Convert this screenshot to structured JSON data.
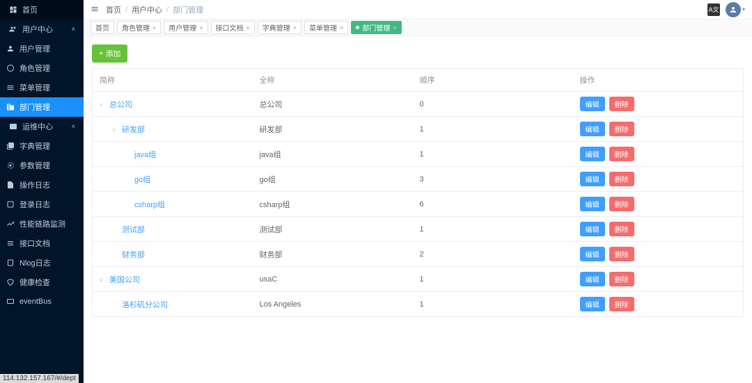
{
  "sidebar": {
    "items": [
      {
        "icon": "dashboard",
        "label": "首页",
        "type": "item"
      },
      {
        "icon": "user",
        "label": "用户中心",
        "type": "group",
        "expanded": true,
        "children": [
          {
            "icon": "person",
            "label": "用户管理"
          },
          {
            "icon": "peace",
            "label": "角色管理"
          },
          {
            "icon": "menu",
            "label": "菜单管理"
          },
          {
            "icon": "dept",
            "label": "部门管理",
            "active": true
          }
        ]
      },
      {
        "icon": "ops",
        "label": "运维中心",
        "type": "group",
        "expanded": true,
        "children": [
          {
            "icon": "dict",
            "label": "字典管理"
          },
          {
            "icon": "param",
            "label": "参数管理"
          },
          {
            "icon": "log",
            "label": "操作日志"
          },
          {
            "icon": "login",
            "label": "登录日志"
          },
          {
            "icon": "perf",
            "label": "性能链路监测"
          },
          {
            "icon": "api",
            "label": "接口文档"
          },
          {
            "icon": "nlog",
            "label": "Nlog日志"
          },
          {
            "icon": "health",
            "label": "健康检查"
          },
          {
            "icon": "bus",
            "label": "eventBus"
          }
        ]
      }
    ]
  },
  "breadcrumb": [
    "首页",
    "用户中心",
    "部门管理"
  ],
  "topbar": {
    "lang_badge": "A文"
  },
  "tabs": [
    {
      "label": "首页",
      "closable": false
    },
    {
      "label": "角色管理",
      "closable": true
    },
    {
      "label": "用户管理",
      "closable": true
    },
    {
      "label": "接口文档",
      "closable": true
    },
    {
      "label": "字典管理",
      "closable": true
    },
    {
      "label": "菜单管理",
      "closable": true
    },
    {
      "label": "部门管理",
      "closable": true,
      "active": true
    }
  ],
  "toolbar": {
    "add_label": "添加"
  },
  "table": {
    "headers": {
      "name": "简称",
      "fullname": "全称",
      "order": "顺序",
      "action": "操作"
    },
    "actions": {
      "edit": "编辑",
      "delete": "删除"
    },
    "rows": [
      {
        "indent": 0,
        "expandable": true,
        "name": "总公司",
        "fullname": "总公司",
        "order": "0"
      },
      {
        "indent": 1,
        "expandable": true,
        "name": "研发部",
        "fullname": "研发部",
        "order": "1"
      },
      {
        "indent": 2,
        "expandable": false,
        "name": "java组",
        "fullname": "java组",
        "order": "1"
      },
      {
        "indent": 2,
        "expandable": false,
        "name": "go组",
        "fullname": "go组",
        "order": "3"
      },
      {
        "indent": 2,
        "expandable": false,
        "name": "csharp组",
        "fullname": "csharp组",
        "order": "6"
      },
      {
        "indent": 1,
        "expandable": false,
        "name": "测试部",
        "fullname": "测试部",
        "order": "1"
      },
      {
        "indent": 1,
        "expandable": false,
        "name": "财务部",
        "fullname": "财务部",
        "order": "2"
      },
      {
        "indent": 0,
        "expandable": true,
        "name": "美国公司",
        "fullname": "usaC",
        "order": "1"
      },
      {
        "indent": 1,
        "expandable": false,
        "name": "洛杉矶分公司",
        "fullname": "Los Angeles",
        "order": "1"
      }
    ]
  },
  "statusbar": "114.132.157.167/#/dept"
}
